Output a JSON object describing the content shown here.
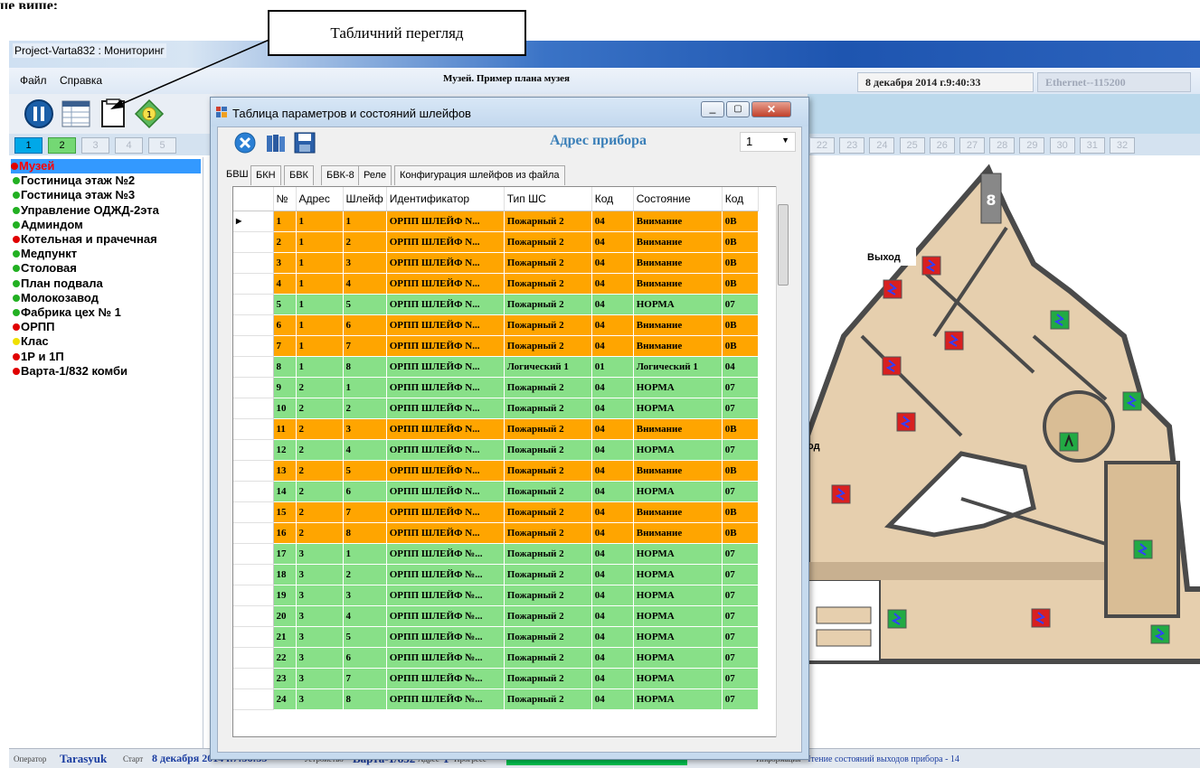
{
  "doc_fragment": "це вище:",
  "callout": {
    "label": "Табличний перегляд"
  },
  "window": {
    "title": "Project-Varta832 : Мониторинг",
    "menu": [
      "Файл",
      "Справка"
    ],
    "header_title": "Музей. Пример плана музея",
    "datetime": "8 декабря 2014 г.9:40:33",
    "connection": "Ethernet--115200"
  },
  "toolbar": {
    "icons": [
      "pause-icon",
      "table-view-icon",
      "blank-page-icon",
      "diamond-1-icon"
    ],
    "diamond_label": "1"
  },
  "number_tabs": {
    "left": [
      "1",
      "2",
      "3",
      "4",
      "5"
    ],
    "right": [
      "22",
      "23",
      "24",
      "25",
      "26",
      "27",
      "28",
      "29",
      "30",
      "31",
      "32"
    ],
    "active": "1",
    "green": "2"
  },
  "objects": [
    {
      "label": "Музей",
      "dot": "#e00000",
      "selected": true
    },
    {
      "label": "Гостиница этаж №2",
      "dot": "#22b022"
    },
    {
      "label": "Гостиница этаж №3",
      "dot": "#22b022"
    },
    {
      "label": "Управление ОДЖД-2эта",
      "dot": "#22b022"
    },
    {
      "label": "Админдом",
      "dot": "#22b022"
    },
    {
      "label": "Котельная и прачечная",
      "dot": "#e00000"
    },
    {
      "label": "Медпункт",
      "dot": "#22b022"
    },
    {
      "label": "Столовая",
      "dot": "#22b022"
    },
    {
      "label": "План подвала",
      "dot": "#22b022"
    },
    {
      "label": "Молокозавод",
      "dot": "#22b022"
    },
    {
      "label": "Фабрика цех № 1",
      "dot": "#22b022"
    },
    {
      "label": "ОРПП",
      "dot": "#e00000"
    },
    {
      "label": "Клас",
      "dot": "#f0e000"
    },
    {
      "label": "1Р и 1П",
      "dot": "#e00000"
    },
    {
      "label": "Варта-1/832 комби",
      "dot": "#e00000"
    }
  ],
  "dialog": {
    "title": "Таблица параметров и состояний  шлейфов",
    "address_label": "Адрес прибора",
    "address_value": "1",
    "tabs": [
      "БВШ",
      "БКН",
      "БВК",
      "БВК-8",
      "Реле",
      "Конфигурация шлейфов из файла"
    ],
    "columns": [
      "№",
      "Адрес",
      "Шлейф",
      "Идентификатор",
      "Тип ШС",
      "Код",
      "Состояние",
      "Код"
    ],
    "rows": [
      [
        "1",
        "1",
        "1",
        "ОРПП ШЛЕЙФ N...",
        "Пожарный 2",
        "04",
        "Внимание",
        "0B",
        "o"
      ],
      [
        "2",
        "1",
        "2",
        "ОРПП ШЛЕЙФ N...",
        "Пожарный 2",
        "04",
        "Внимание",
        "0B",
        "o"
      ],
      [
        "3",
        "1",
        "3",
        "ОРПП ШЛЕЙФ N...",
        "Пожарный 2",
        "04",
        "Внимание",
        "0B",
        "o"
      ],
      [
        "4",
        "1",
        "4",
        "ОРПП ШЛЕЙФ N...",
        "Пожарный 2",
        "04",
        "Внимание",
        "0B",
        "o"
      ],
      [
        "5",
        "1",
        "5",
        "ОРПП ШЛЕЙФ N...",
        "Пожарный 2",
        "04",
        "НОРМА",
        "07",
        "g"
      ],
      [
        "6",
        "1",
        "6",
        "ОРПП ШЛЕЙФ N...",
        "Пожарный 2",
        "04",
        "Внимание",
        "0B",
        "o"
      ],
      [
        "7",
        "1",
        "7",
        "ОРПП ШЛЕЙФ N...",
        "Пожарный 2",
        "04",
        "Внимание",
        "0B",
        "o"
      ],
      [
        "8",
        "1",
        "8",
        "ОРПП ШЛЕЙФ N...",
        "Логический 1",
        "01",
        "Логический 1",
        "04",
        "g"
      ],
      [
        "9",
        "2",
        "1",
        "ОРПП ШЛЕЙФ N...",
        "Пожарный 2",
        "04",
        "НОРМА",
        "07",
        "g"
      ],
      [
        "10",
        "2",
        "2",
        "ОРПП ШЛЕЙФ N...",
        "Пожарный 2",
        "04",
        "НОРМА",
        "07",
        "g"
      ],
      [
        "11",
        "2",
        "3",
        "ОРПП ШЛЕЙФ N...",
        "Пожарный 2",
        "04",
        "Внимание",
        "0B",
        "o"
      ],
      [
        "12",
        "2",
        "4",
        "ОРПП ШЛЕЙФ N...",
        "Пожарный 2",
        "04",
        "НОРМА",
        "07",
        "g"
      ],
      [
        "13",
        "2",
        "5",
        "ОРПП ШЛЕЙФ N...",
        "Пожарный 2",
        "04",
        "Внимание",
        "0B",
        "o"
      ],
      [
        "14",
        "2",
        "6",
        "ОРПП ШЛЕЙФ N...",
        "Пожарный 2",
        "04",
        "НОРМА",
        "07",
        "g"
      ],
      [
        "15",
        "2",
        "7",
        "ОРПП ШЛЕЙФ N...",
        "Пожарный 2",
        "04",
        "Внимание",
        "0B",
        "o"
      ],
      [
        "16",
        "2",
        "8",
        "ОРПП ШЛЕЙФ N...",
        "Пожарный 2",
        "04",
        "Внимание",
        "0B",
        "o"
      ],
      [
        "17",
        "3",
        "1",
        "ОРПП ШЛЕЙФ №...",
        "Пожарный 2",
        "04",
        "НОРМА",
        "07",
        "g"
      ],
      [
        "18",
        "3",
        "2",
        "ОРПП ШЛЕЙФ №...",
        "Пожарный 2",
        "04",
        "НОРМА",
        "07",
        "g"
      ],
      [
        "19",
        "3",
        "3",
        "ОРПП ШЛЕЙФ №...",
        "Пожарный 2",
        "04",
        "НОРМА",
        "07",
        "g"
      ],
      [
        "20",
        "3",
        "4",
        "ОРПП ШЛЕЙФ №...",
        "Пожарный 2",
        "04",
        "НОРМА",
        "07",
        "g"
      ],
      [
        "21",
        "3",
        "5",
        "ОРПП ШЛЕЙФ №...",
        "Пожарный 2",
        "04",
        "НОРМА",
        "07",
        "g"
      ],
      [
        "22",
        "3",
        "6",
        "ОРПП ШЛЕЙФ №...",
        "Пожарный 2",
        "04",
        "НОРМА",
        "07",
        "g"
      ],
      [
        "23",
        "3",
        "7",
        "ОРПП ШЛЕЙФ №...",
        "Пожарный 2",
        "04",
        "НОРМА",
        "07",
        "g"
      ],
      [
        "24",
        "3",
        "8",
        "ОРПП ШЛЕЙФ №...",
        "Пожарный 2",
        "04",
        "НОРМА",
        "07",
        "g"
      ]
    ]
  },
  "map": {
    "labels": [
      "8",
      "Выход",
      "од"
    ]
  },
  "status": {
    "operator_label": "Оператор",
    "operator": "Tarasyuk",
    "start_label": "Старт",
    "start": "8 декабря 2014 г.7:56:53",
    "device_label": "Устройство",
    "device": "Варта-1/832",
    "address_label": "Адрес",
    "address": "1",
    "progress_label": "Прогресс",
    "info_label": "Информация",
    "info": "Чтение состояний выходов прибора - 14"
  },
  "colors": {
    "alarm": "#ffa500",
    "normal": "#88e088",
    "accent": "#00a8e8"
  }
}
